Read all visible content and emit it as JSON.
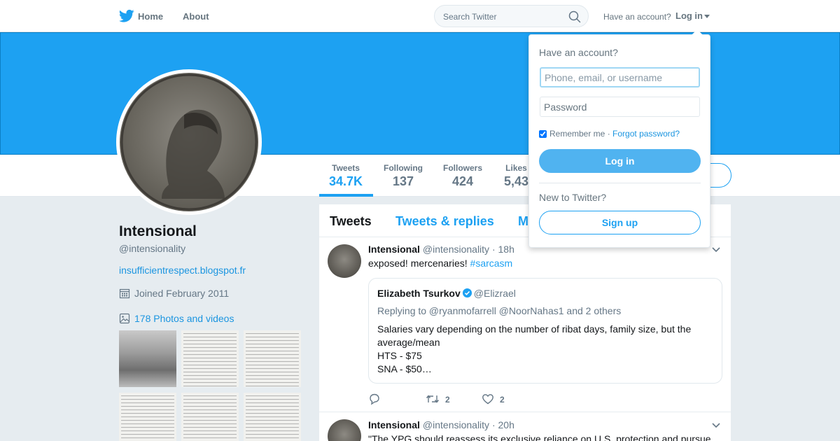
{
  "nav": {
    "home_label": "Home",
    "about_label": "About",
    "search_placeholder": "Search Twitter",
    "have_account": "Have an account?",
    "login_label": "Log in"
  },
  "colors": {
    "brand": "#1da1f2",
    "link": "#1b95e0",
    "muted": "#657786"
  },
  "profile": {
    "name": "Intensional",
    "handle": "@intensionality",
    "website": "insufficientrespect.blogspot.fr",
    "joined": "Joined February 2011",
    "photos": "178 Photos and videos",
    "avatar_icon": "medal-portrait-image"
  },
  "stats": [
    {
      "label": "Tweets",
      "value": "34.7K"
    },
    {
      "label": "Following",
      "value": "137"
    },
    {
      "label": "Followers",
      "value": "424"
    },
    {
      "label": "Likes",
      "value": "5,43"
    }
  ],
  "tabs": [
    "Tweets",
    "Tweets & replies",
    "M"
  ],
  "tweets": [
    {
      "name": "Intensional",
      "handle": "@intensionality",
      "time": "· 18h",
      "text": "exposed!  mercenaries!  ",
      "hashtag": "#sarcasm",
      "quote": {
        "name": "Elizabeth Tsurkov",
        "handle": "@Elizrael",
        "reply": "Replying to @ryanmofarrell @NoorNahas1 and 2 others",
        "line1": "Salaries vary depending on the number of ribat days, family size, but the average/mean",
        "line2": "HTS - $75",
        "line3": "SNA - $50…"
      },
      "retweets": "2",
      "likes": "2"
    },
    {
      "name": "Intensional",
      "handle": "@intensionality",
      "time": "· 20h",
      "text": "\"The YPG should reassess its exclusive reliance on U.S. protection and pursue"
    }
  ],
  "login_dropdown": {
    "title": "Have an account?",
    "username_placeholder": "Phone, email, or username",
    "password_placeholder": "Password",
    "remember": "Remember me",
    "separator": "·",
    "forgot": "Forgot password?",
    "login_button": "Log in",
    "new_to": "New to Twitter?",
    "signup_button": "Sign up"
  }
}
